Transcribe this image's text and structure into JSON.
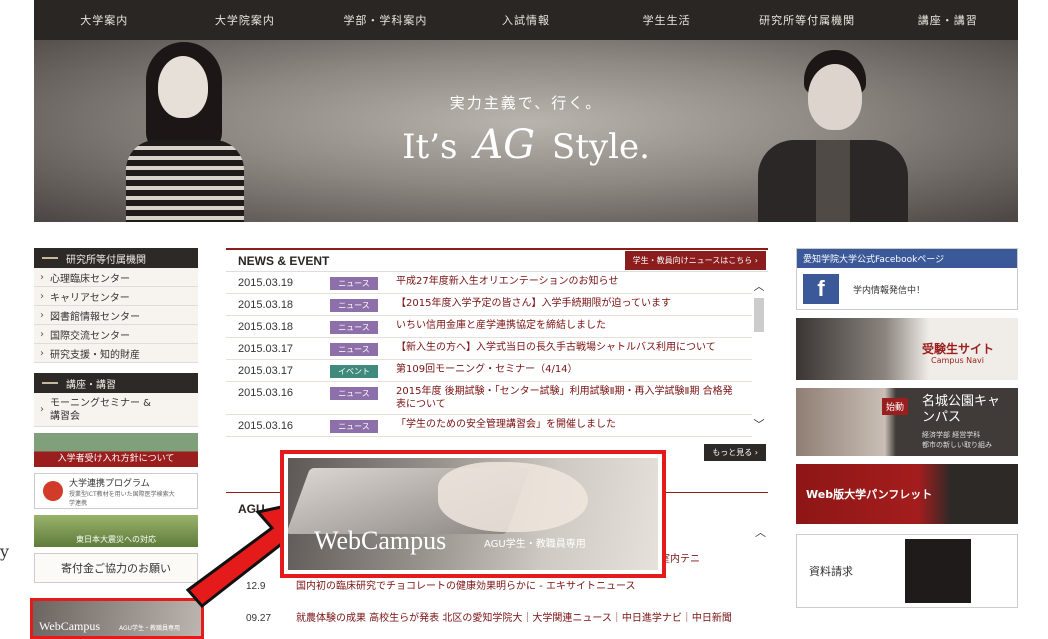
{
  "nav": {
    "items": [
      "大学案内",
      "大学院案内",
      "学部・学科案内",
      "入試情報",
      "学生生活",
      "研究所等付属機関",
      "講座・講習"
    ]
  },
  "hero": {
    "catchphrase": "実力主義で、行く。",
    "slogan_left": "It’s",
    "slogan_logo": "AG",
    "slogan_right": "Style."
  },
  "sidebar": {
    "section1_title": "研究所等付属機関",
    "section1_items": [
      "心理臨床センター",
      "キャリアセンター",
      "図書館情報センター",
      "国際交流センター",
      "研究支援・知的財産"
    ],
    "section2_title": "講座・講習",
    "section2_items": [
      "モーニングセミナー & 講習会"
    ],
    "banner_admission": "入学者受け入れ方針について",
    "banner_program_title": "大学連携プログラム",
    "banner_program_sub": "授業型ICT教材を用いた国際医学検索大学連携",
    "banner_earthquake": "東日本大震災への対応",
    "banner_donation": "寄付金ご協力のお願い",
    "webcampus": "WebCampus",
    "webcampus_sub": "AGU学生・教職員専用"
  },
  "news": {
    "title": "NEWS & EVENT",
    "header_link": "学生・教員向けニュースはこちら",
    "more": "もっと見る",
    "items": [
      {
        "date": "2015.03.19",
        "tag": "ニュース",
        "text": "平成27年度新入生オリエンテーションのお知らせ",
        "event": false
      },
      {
        "date": "2015.03.18",
        "tag": "ニュース",
        "text": "【2015年度入学予定の皆さん】入学手続期限が迫っています",
        "event": false
      },
      {
        "date": "2015.03.18",
        "tag": "ニュース",
        "text": "いちい信用金庫と産学連携協定を締結しました",
        "event": false
      },
      {
        "date": "2015.03.17",
        "tag": "ニュース",
        "text": "【新入生の方へ】入学式当日の長久手古戦場シャトルバス利用について",
        "event": false
      },
      {
        "date": "2015.03.17",
        "tag": "イベント",
        "text": "第109回モーニング・セミナー（4/14）",
        "event": true
      },
      {
        "date": "2015.03.16",
        "tag": "ニュース",
        "text": "2015年度 後期試験・「センター試験」利用試験Ⅱ期・再入学試験Ⅱ期 合格発表について",
        "event": false
      },
      {
        "date": "2015.03.16",
        "tag": "ニュース",
        "text": "「学生のための安全管理講習会」を開催しました",
        "event": false
      }
    ]
  },
  "agu": {
    "label": "AGU",
    "partial_text": "生室内テニ",
    "items": [
      {
        "date": "12.9",
        "text": "国内初の臨床研究でチョコレートの健康効果明らかに - エキサイトニュース"
      },
      {
        "date": "09.27",
        "text": "就農体験の成果 高校生らが発表 北区の愛知学院大｜大学関連ニュース｜中日進学ナビ｜中日新聞"
      }
    ]
  },
  "right": {
    "facebook_title": "愛知学院大学公式Facebookページ",
    "facebook_text": "学内情報発信中！",
    "exam_site": "受験生サイト",
    "exam_site_sub": "Campus Navi",
    "campus_tag": "始動",
    "campus_title": "名城公園キャンパス",
    "campus_sub1": "経済学部 経営学科",
    "campus_sub2": "都市の新しい取り組み",
    "pamphlet": "Web版大学パンフレット",
    "request": "資料請求"
  },
  "callout": {
    "title": "WebCampus",
    "subtitle": "AGU学生・教職員専用"
  },
  "edge_char": "y",
  "colors": {
    "accent_red": "#8b1d1d",
    "highlight_red": "#e51b1b",
    "dark": "#2a2624"
  }
}
